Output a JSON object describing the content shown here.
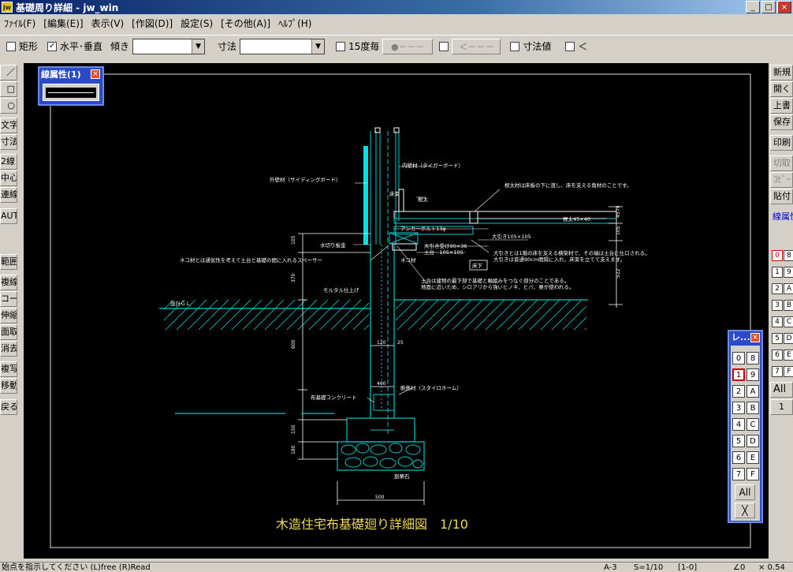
{
  "window": {
    "icon": "jw",
    "title": "基礎周り詳細 - jw_win",
    "minimize": "_",
    "maximize": "□",
    "close": "×"
  },
  "menu": [
    "ﾌｧｲﾙ(F)",
    "[編集(E)]",
    "表示(V)",
    "[作図(D)]",
    "設定(S)",
    "[その他(A)]",
    "ﾍﾙﾌﾟ(H)"
  ],
  "toolbar": {
    "rect_label": "矩形",
    "horiz_vert_label": "水平･垂直",
    "horiz_vert_checked": "✓",
    "slope_label": "傾き",
    "dim_label": "寸法",
    "deg15_label": "15度毎",
    "btn_a": "●－－－",
    "btn_b": "＜－－－",
    "dimval_label": "寸法値",
    "lt_label": "＜"
  },
  "left_tools": [
    "／",
    "□",
    "○",
    "文字",
    "寸法",
    "2線",
    "中心線",
    "連線",
    "AUTO",
    "範囲",
    "複線",
    "コーナー",
    "伸縮",
    "面取",
    "消去",
    "複写",
    "移動",
    "戻る"
  ],
  "right_tools": [
    "新規",
    "開く",
    "上書",
    "保存",
    "印刷",
    "切取",
    "ｺﾋﾟｰ",
    "貼付",
    "線属性"
  ],
  "right_layers": [
    "0",
    "8",
    "1",
    "9",
    "2",
    "A",
    "3",
    "B",
    "4",
    "C",
    "5",
    "D",
    "6",
    "E",
    "7",
    "F"
  ],
  "right_all": "All",
  "right_one": "1",
  "line_attr_window": {
    "title": "線属性(1)",
    "close": "×"
  },
  "layer_window": {
    "title": "レ...",
    "close": "×",
    "buttons": [
      "0",
      "8",
      "1",
      "9",
      "2",
      "A",
      "3",
      "B",
      "4",
      "C",
      "5",
      "D",
      "6",
      "E",
      "7",
      "F"
    ],
    "all": "All",
    "x": "╳"
  },
  "drawing": {
    "title": "木造住宅布基礎廻り詳細図　1/10",
    "labels": {
      "inner_wall": "内壁材（タイガーボード）",
      "outer_wall": "外壁材（サイディングボード）",
      "sill_note": "根太材は床板の下に渡し、床を支える角材のことです。",
      "nedasu": "根太",
      "nedasu_dim": "根太45×40",
      "anchor": "アンカーボルト13φ",
      "obiki": "大引き105×105",
      "obiki_dim": "大引き受け90×36",
      "dodai": "土台　105×105",
      "mizukiri": "水切り板金",
      "obiki_note1": "大引きとは1階の床を支える横架材で、その端は土台に仕口される。",
      "obiki_note2": "大引きは普通90cm間隔に入れ、床束を立てて支えます。",
      "neko_note": "ネコ材とは通気性を考えて土台と基礎の間に入れるスペーサー",
      "neko": "ネコ材",
      "dodai_note1": "土台は建物の最下部で基礎と軸組みをつなぐ部分のことである。",
      "dodai_note2": "地面に近いため、シロアリから強いヒノキ、ヒバ、栗が使われる。",
      "mortar": "モルタル仕上げ",
      "gl": "設計ＧＬ",
      "concrete": "布基礎コンクリート",
      "insulation": "断熱材（スタイロホーム）",
      "gravel": "割栗石",
      "yukashita": "床下",
      "yukazuka": "床束"
    },
    "dims": {
      "d105": "105",
      "d370": "370",
      "d600": "600",
      "d150": "150",
      "d180": "180",
      "d120": "120",
      "d25": "25",
      "d400": "400",
      "d500": "500",
      "r74": "74",
      "r105": "105",
      "r522": "522",
      "r45": "45"
    }
  },
  "status": {
    "prompt": "始点を指示してください (L)free (R)Read",
    "paper": "A-3",
    "scale": "S=1/10",
    "layer": "[1-0]",
    "angle": "∠0",
    "zoom": "× 0.54"
  }
}
